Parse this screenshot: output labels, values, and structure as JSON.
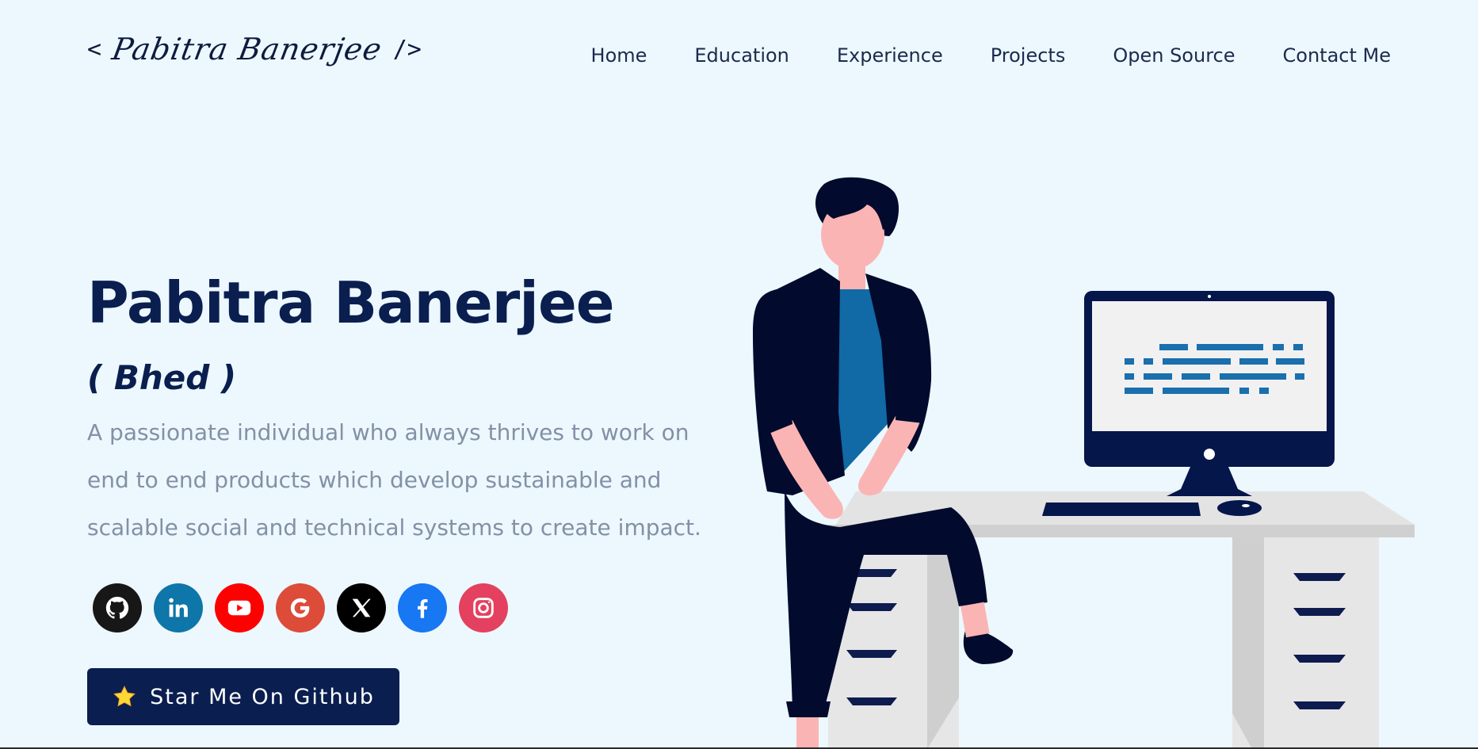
{
  "logo": {
    "open": "<",
    "name": "Pabitra Banerjee",
    "close": "/>"
  },
  "nav": [
    "Home",
    "Education",
    "Experience",
    "Projects",
    "Open Source",
    "Contact Me"
  ],
  "hero": {
    "title": "Pabitra Banerjee",
    "nickname": "( Bhed )",
    "description": "A passionate individual who always thrives to work on end to end products which develop sustainable and scalable social and technical systems to create impact."
  },
  "socials": [
    {
      "name": "github-icon",
      "color": "#181717"
    },
    {
      "name": "linkedin-icon",
      "color": "#0e76a8"
    },
    {
      "name": "youtube-icon",
      "color": "#ff0000"
    },
    {
      "name": "google-icon",
      "color": "#dd4b39"
    },
    {
      "name": "x-icon",
      "color": "#000000"
    },
    {
      "name": "facebook-icon",
      "color": "#1877f2"
    },
    {
      "name": "instagram-icon",
      "color": "#e4405f"
    }
  ],
  "cta": {
    "label": "Star Me On Github",
    "icon": "star-icon"
  },
  "colors": {
    "background": "#ecf8fd",
    "primary": "#0a1e4f",
    "text_muted": "#8390a6",
    "accent": "#1a6fad"
  }
}
